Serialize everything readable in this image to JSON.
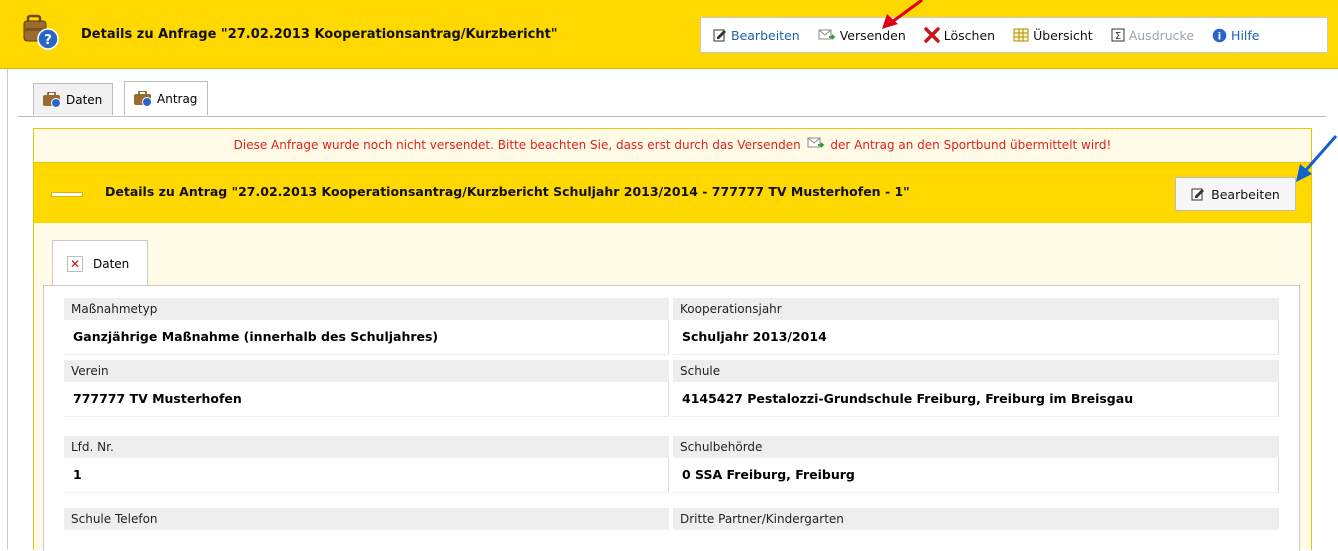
{
  "header": {
    "title": "Details zu  Anfrage \"27.02.2013 Kooperationsantrag/Kurzbericht\""
  },
  "toolbar": {
    "edit": "Bearbeiten",
    "send": "Versenden",
    "delete": "Löschen",
    "overview": "Übersicht",
    "printouts": "Ausdrucke",
    "help": "Hilfe"
  },
  "tabs": {
    "daten": "Daten",
    "antrag": "Antrag"
  },
  "notice": {
    "before": "Diese Anfrage wurde noch nicht versendet. Bitte beachten Sie, dass erst durch das Versenden",
    "after": "der Antrag an den Sportbund übermittelt wird!"
  },
  "panel": {
    "title": "Details zu Antrag \"27.02.2013 Kooperationsantrag/Kurzbericht Schuljahr 2013/2014 - 777777 TV Musterhofen - 1\"",
    "edit": "Bearbeiten",
    "subtab": "Daten"
  },
  "fields": [
    {
      "label": "Maßnahmetyp",
      "value": "Ganzjährige Maßnahme (innerhalb des Schuljahres)"
    },
    {
      "label": "Kooperationsjahr",
      "value": "Schuljahr 2013/2014"
    },
    {
      "label": "Verein",
      "value": "777777 TV Musterhofen"
    },
    {
      "label": "Schule",
      "value": "4145427 Pestalozzi-Grundschule Freiburg, Freiburg im Breisgau"
    },
    {
      "label": "Lfd. Nr.",
      "value": "1"
    },
    {
      "label": "Schulbehörde",
      "value": "0 SSA Freiburg, Freiburg"
    },
    {
      "label": "Schule Telefon",
      "value": ""
    },
    {
      "label": "Dritte Partner/Kindergarten",
      "value": ""
    }
  ],
  "colors": {
    "accent_yellow": "#ffd800",
    "link_blue": "#1f5fb3",
    "notice_red": "#e02020",
    "arrow_red": "#e0001a",
    "arrow_blue": "#1060d0"
  }
}
